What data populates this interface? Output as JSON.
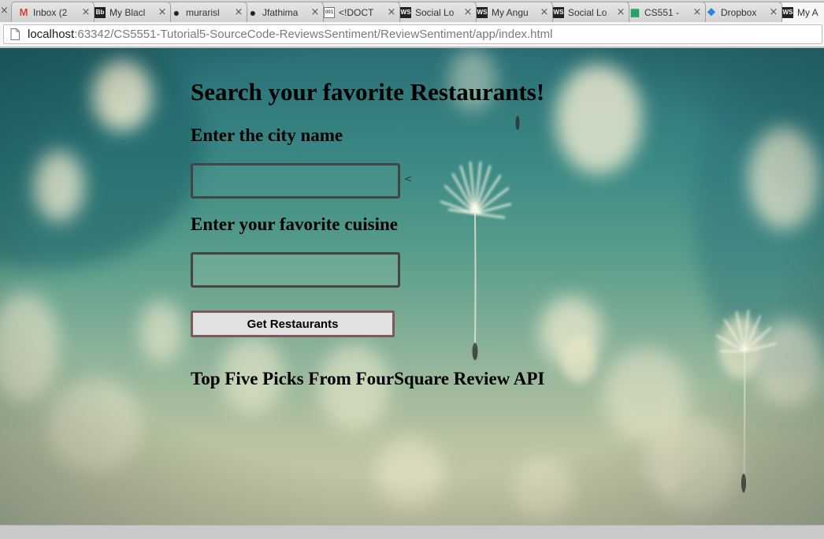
{
  "browser": {
    "tabs": [
      {
        "label": "Inbox (2",
        "icon": "gmail-icon",
        "icon_glyph": "M",
        "icon_color": "#d44638",
        "active": false
      },
      {
        "label": "My Blacl",
        "icon": "blackboard-icon",
        "icon_glyph": "Bb",
        "icon_color": "#222222",
        "active": false
      },
      {
        "label": "murarisl",
        "icon": "github-icon",
        "icon_glyph": "●",
        "icon_color": "#222222",
        "active": false
      },
      {
        "label": "Jfathima",
        "icon": "github-icon",
        "icon_glyph": "●",
        "icon_color": "#222222",
        "active": false
      },
      {
        "label": "<!DOCT",
        "icon": "file-code-icon",
        "icon_glyph": "001",
        "icon_color": "#555555",
        "active": false
      },
      {
        "label": "Social Lo",
        "icon": "webstorm-icon",
        "icon_glyph": "WS",
        "icon_color": "#333333",
        "active": false
      },
      {
        "label": "My Angu",
        "icon": "webstorm-icon",
        "icon_glyph": "WS",
        "icon_color": "#333333",
        "active": false
      },
      {
        "label": "Social Lo",
        "icon": "webstorm-icon",
        "icon_glyph": "WS",
        "icon_color": "#333333",
        "active": false
      },
      {
        "label": "CS551 -",
        "icon": "google-sheets-icon",
        "icon_glyph": "▦",
        "icon_color": "#0f9d58",
        "active": false
      },
      {
        "label": "Dropbox",
        "icon": "dropbox-icon",
        "icon_glyph": "❖",
        "icon_color": "#1f7fe0",
        "active": false
      },
      {
        "label": "My A",
        "icon": "webstorm-icon",
        "icon_glyph": "WS",
        "icon_color": "#333333",
        "active": true
      }
    ],
    "close_glyph": "×",
    "url_host": "localhost",
    "url_path": ":63342/CS5551-Tutorial5-SourceCode-ReviewsSentiment/ReviewSentiment/app/index.html"
  },
  "page": {
    "heading": "Search your favorite Restaurants!",
    "city_label": "Enter the city name",
    "city_value": "",
    "stray_text": "<",
    "cuisine_label": "Enter your favorite cuisine",
    "cuisine_value": "",
    "button_label": "Get Restaurants",
    "results_heading": "Top Five Picks From FourSquare Review API"
  }
}
